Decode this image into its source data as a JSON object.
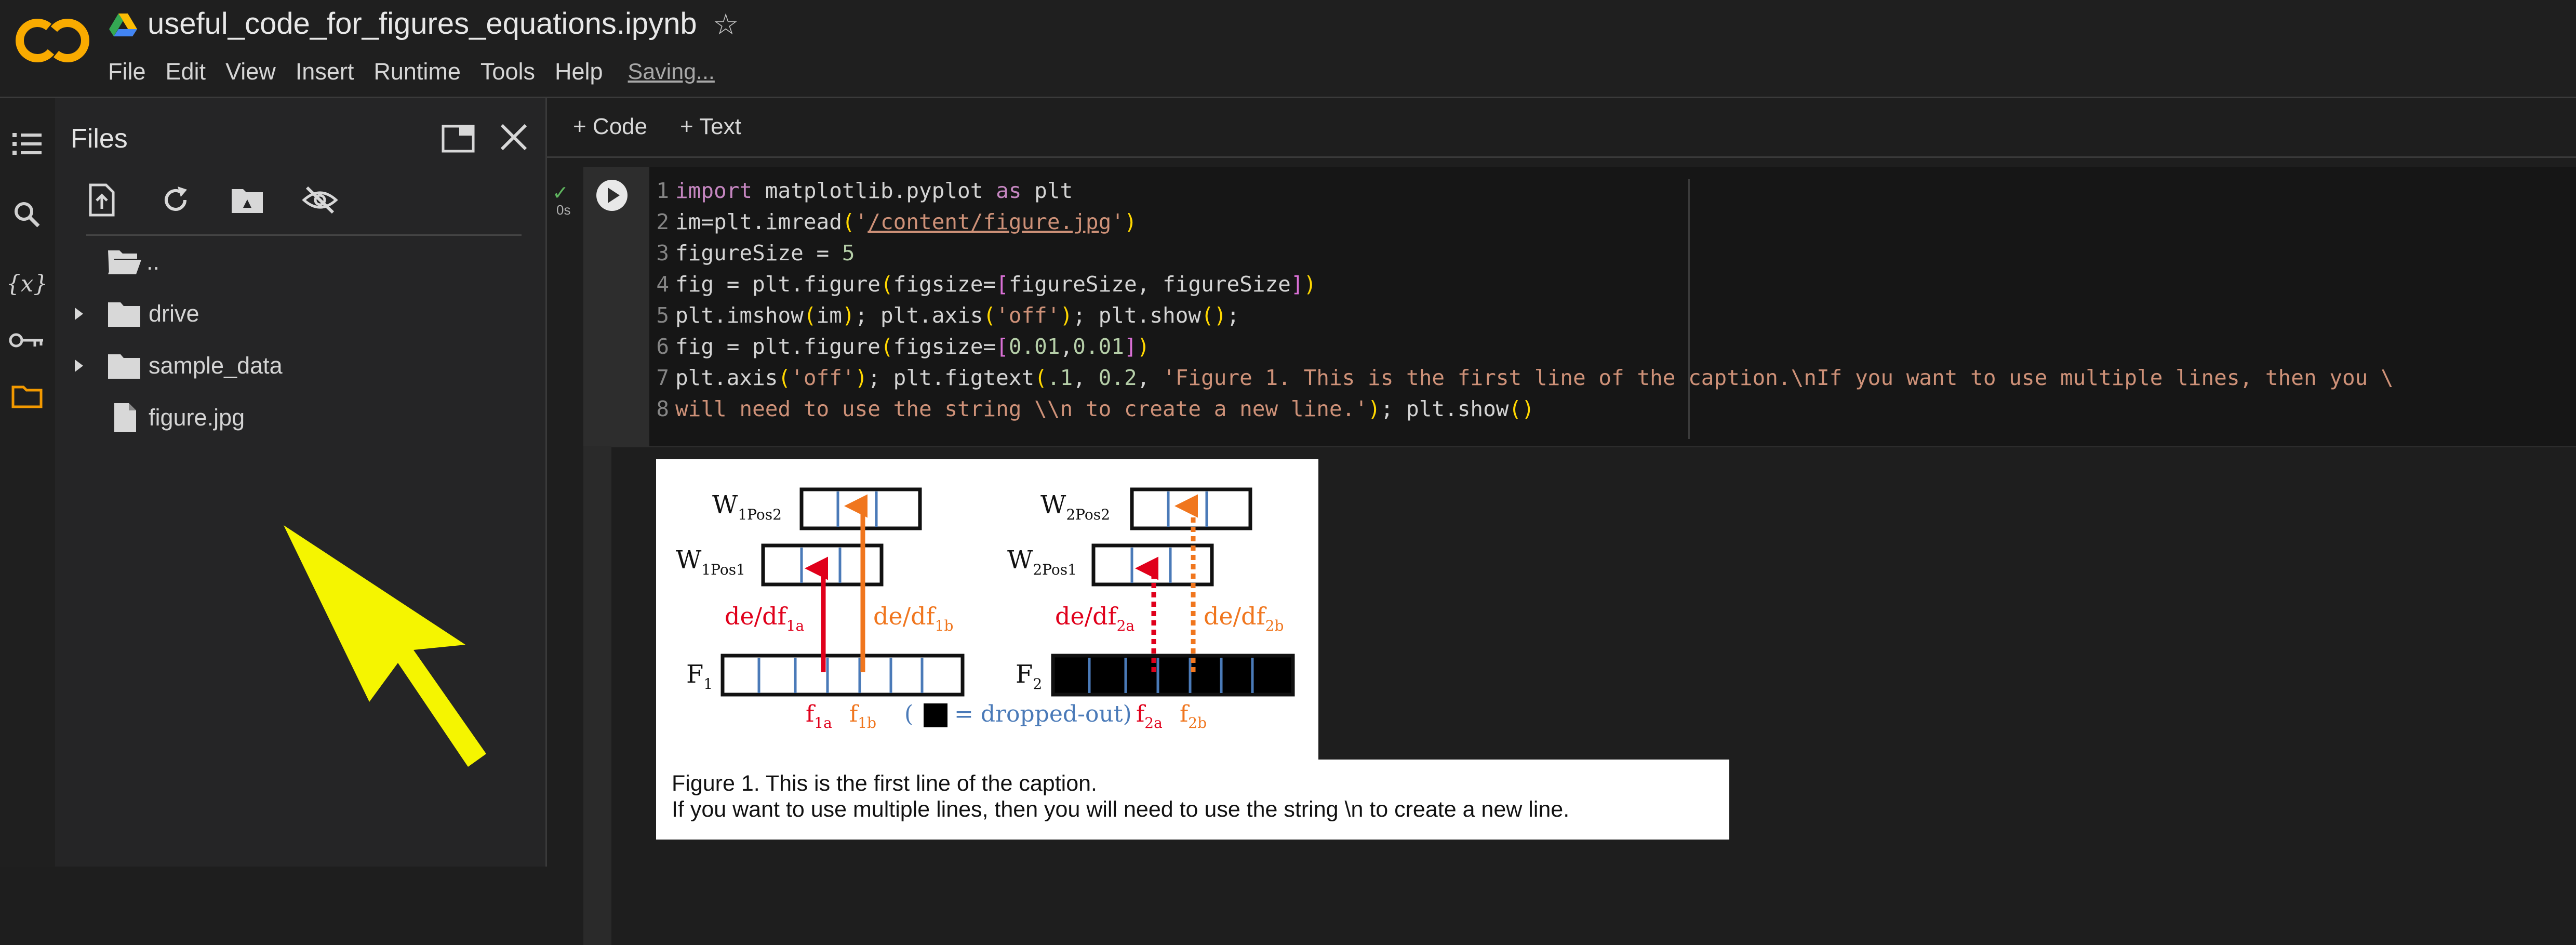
{
  "app": {
    "notebook_title": "useful_code_for_figures_equations.ipynb",
    "menu": [
      "File",
      "Edit",
      "View",
      "Insert",
      "Runtime",
      "Tools",
      "Help"
    ],
    "status": "Saving...",
    "logo_text": "CO"
  },
  "files_panel": {
    "title": "Files",
    "tree": [
      {
        "label": "..",
        "type": "folder-open",
        "expandable": false
      },
      {
        "label": "drive",
        "type": "folder",
        "expandable": true
      },
      {
        "label": "sample_data",
        "type": "folder",
        "expandable": true
      },
      {
        "label": "figure.jpg",
        "type": "file",
        "expandable": false
      }
    ]
  },
  "notebook": {
    "add_code": "+ Code",
    "add_text": "+ Text",
    "cell": {
      "exec_time": "0s",
      "line_numbers": [
        "1",
        "2",
        "3",
        "4",
        "5",
        "6",
        "7",
        "8"
      ],
      "code": [
        "import matplotlib.pyplot as plt",
        "im=plt.imread('/content/figure.jpg')",
        "figureSize = 5",
        "fig = plt.figure(figsize=[figureSize, figureSize])",
        "plt.imshow(im); plt.axis('off'); plt.show();",
        "fig = plt.figure(figsize=[0.01,0.01])",
        "plt.axis('off'); plt.figtext(.1, 0.2, 'Figure 1. This is the first line of the caption.\\nIf you want to use multiple lines, then you \\",
        "will need to use the string \\\\n to create a new line.'); plt.show()"
      ]
    },
    "output": {
      "caption_line1": "Figure 1. This is the first line of the caption.",
      "caption_line2": "If you want to use multiple lines, then you will need to use the string \\n to create a new line.",
      "figure": {
        "w1pos2": "W",
        "w1pos2_sub": "1Pos2",
        "w1pos1": "W",
        "w1pos1_sub": "1Pos1",
        "w2pos2": "W",
        "w2pos2_sub": "2Pos2",
        "w2pos1": "W",
        "w2pos1_sub": "2Pos1",
        "de_df1a": "de/df",
        "de_df1a_sub": "1a",
        "de_df1b": "de/df",
        "de_df1b_sub": "1b",
        "de_df2a": "de/df",
        "de_df2a_sub": "2a",
        "de_df2b": "de/df",
        "de_df2b_sub": "2b",
        "f1": "F",
        "f1_sub": "1",
        "f2": "F",
        "f2_sub": "2",
        "f1a": "f",
        "f1a_sub": "1a",
        "f1b": "f",
        "f1b_sub": "1b",
        "f2a": "f",
        "f2a_sub": "2a",
        "f2b": "f",
        "f2b_sub": "2b",
        "legend_open": "(",
        "legend_text": "= dropped-out)",
        "colors": {
          "red": "#e0001b",
          "orange": "#f0761e",
          "blue": "#4a7ab8"
        }
      }
    }
  }
}
